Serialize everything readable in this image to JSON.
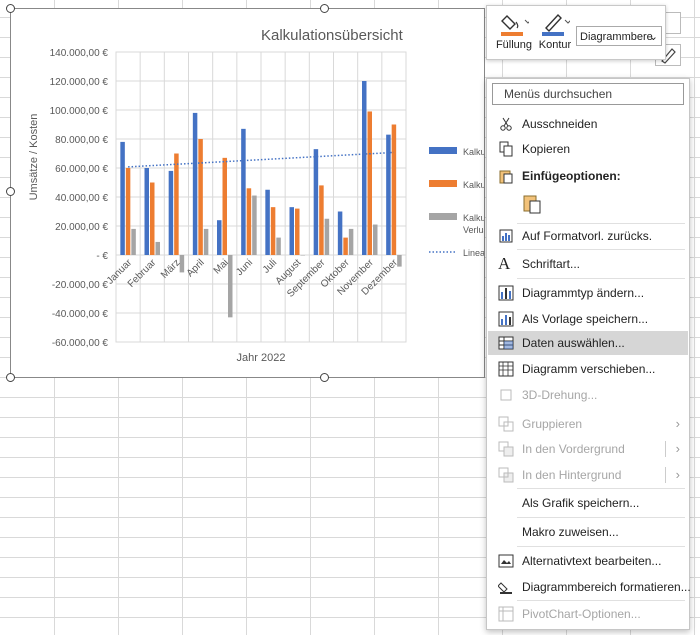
{
  "chart_data": {
    "type": "bar",
    "title": "Kalkulationsübersicht",
    "xlabel": "Jahr 2022",
    "ylabel": "Umsätze / Kosten",
    "ylim": [
      -60000,
      140000
    ],
    "y_ticks": [
      "140.000,00 €",
      "120.000,00 €",
      "100.000,00 €",
      "80.000,00 €",
      "60.000,00 €",
      "40.000,00 €",
      "20.000,00 €",
      "-   €",
      "-20.000,00 €",
      "-40.000,00 €",
      "-60.000,00 €"
    ],
    "categories": [
      "Januar",
      "Februar",
      "März",
      "April",
      "Mai",
      "Juni",
      "Juli",
      "August",
      "September",
      "Oktober",
      "November",
      "Dezember"
    ],
    "series": [
      {
        "name": "Kalkul",
        "color": "#4472c4",
        "values": [
          78000,
          60000,
          58000,
          98000,
          24000,
          87000,
          45000,
          33000,
          73000,
          30000,
          120000,
          83000
        ]
      },
      {
        "name": "Kalkul",
        "color": "#ed7d31",
        "values": [
          60000,
          50000,
          70000,
          80000,
          67000,
          46000,
          33000,
          32000,
          48000,
          12000,
          99000,
          90000
        ]
      },
      {
        "name": "Kalkul Verlus",
        "color": "#a5a5a5",
        "values": [
          18000,
          9000,
          -12000,
          18000,
          -43000,
          41000,
          12000,
          0,
          25000,
          18000,
          21000,
          -8000
        ]
      }
    ],
    "trendline": {
      "name": "Linea",
      "color": "#4472c4",
      "style": "dotted"
    },
    "grid": true,
    "legend": "right"
  },
  "minibar": {
    "fill_label": "Füllung",
    "outline_label": "Kontur",
    "element_combo": "Diagrammbere"
  },
  "menu": {
    "search_placeholder": "Menüs durchsuchen",
    "items": [
      {
        "label": "Ausschneiden",
        "icon": "scissors-icon"
      },
      {
        "label": "Kopieren",
        "icon": "copy-icon"
      },
      {
        "label": "Einfügeoptionen:",
        "icon": "paste-icon"
      },
      {
        "label": "Auf Formatvorl. zurücks.",
        "icon": "reset-style-icon"
      },
      {
        "label": "Schriftart...",
        "icon": "font-icon"
      },
      {
        "label": "Diagrammtyp ändern...",
        "icon": "chart-type-icon"
      },
      {
        "label": "Als Vorlage speichern...",
        "icon": "save-template-icon"
      },
      {
        "label": "Daten auswählen...",
        "icon": "select-data-icon"
      },
      {
        "label": "Diagramm verschieben...",
        "icon": "move-chart-icon"
      },
      {
        "label": "3D-Drehung...",
        "icon": "3d-rotation-icon"
      },
      {
        "label": "Gruppieren",
        "icon": "group-icon"
      },
      {
        "label": "In den Vordergrund",
        "icon": "bring-forward-icon"
      },
      {
        "label": "In den Hintergrund",
        "icon": "send-backward-icon"
      },
      {
        "label": "Als Grafik speichern...",
        "icon": ""
      },
      {
        "label": "Makro zuweisen...",
        "icon": ""
      },
      {
        "label": "Alternativtext bearbeiten...",
        "icon": "alt-text-icon"
      },
      {
        "label": "Diagrammbereich formatieren...",
        "icon": "format-area-icon"
      },
      {
        "label": "PivotChart-Optionen...",
        "icon": "pivot-options-icon"
      }
    ]
  }
}
